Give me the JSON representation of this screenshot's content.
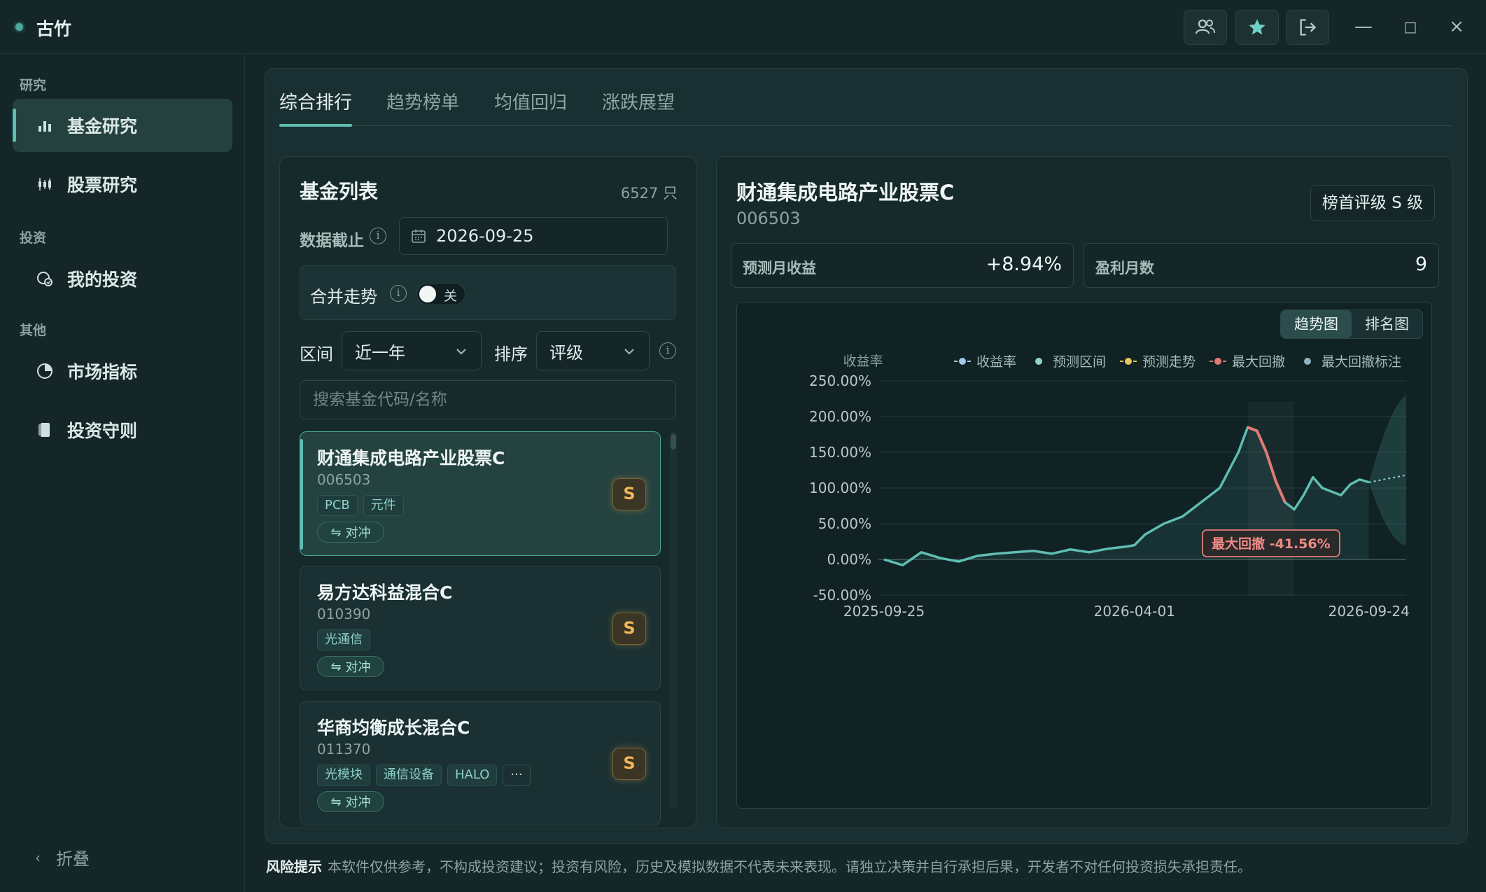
{
  "app": {
    "name": "古竹"
  },
  "window": {
    "minimize": "—",
    "maximize": "□",
    "close": "×"
  },
  "sidebar": {
    "sections": [
      {
        "label": "研究"
      },
      {
        "label": "投资"
      },
      {
        "label": "其他"
      }
    ],
    "items": [
      {
        "label": "基金研究",
        "icon": "bar-chart-icon"
      },
      {
        "label": "股票研究",
        "icon": "candlestick-icon"
      },
      {
        "label": "我的投资",
        "icon": "portfolio-icon"
      },
      {
        "label": "市场指标",
        "icon": "pie-chart-icon"
      },
      {
        "label": "投资守则",
        "icon": "book-icon"
      }
    ],
    "collapse_label": "折叠"
  },
  "tabs": [
    {
      "label": "综合排行",
      "active": true
    },
    {
      "label": "趋势榜单"
    },
    {
      "label": "均值回归"
    },
    {
      "label": "涨跌展望"
    }
  ],
  "fund_list": {
    "title": "基金列表",
    "count": "6527 只",
    "date_label": "数据截止",
    "date_value": "2026-09-25",
    "merge_label": "合并走势",
    "merge_toggle": "关",
    "range_label": "区间",
    "range_value": "近一年",
    "sort_label": "排序",
    "sort_value": "评级",
    "search_placeholder": "搜索基金代码/名称",
    "items": [
      {
        "name": "财通集成电路产业股票C",
        "code": "006503",
        "tags": [
          "PCB",
          "元件"
        ],
        "hedge": "对冲",
        "grade": "S"
      },
      {
        "name": "易方达科益混合C",
        "code": "010390",
        "tags": [
          "光通信"
        ],
        "hedge": "对冲",
        "grade": "S"
      },
      {
        "name": "华商均衡成长混合C",
        "code": "011370",
        "tags": [
          "光模块",
          "通信设备",
          "HALO",
          "···"
        ],
        "hedge": "对冲",
        "grade": "S"
      }
    ]
  },
  "detail": {
    "name": "财通集成电路产业股票C",
    "code": "006503",
    "rank_badge": "榜首评级 S 级",
    "metrics": [
      {
        "label": "预测月收益",
        "value": "+8.94%"
      },
      {
        "label": "盈利月数",
        "value": "9"
      }
    ],
    "views": [
      "趋势图",
      "排名图"
    ],
    "colors": {
      "accent": "#5fbdb2",
      "drawdown": "#e07a76",
      "forecast": "#e8c65a",
      "grade": "#f0b65a"
    }
  },
  "chart_data": {
    "type": "line",
    "title": "",
    "ylabel": "收益率",
    "ylim": [
      -50,
      250
    ],
    "yticks": [
      "250.00%",
      "200.00%",
      "150.00%",
      "100.00%",
      "50.00%",
      "0.00%",
      "-50.00%"
    ],
    "xticks": [
      "2025-09-25",
      "2026-04-01",
      "2026-09-24"
    ],
    "legend": [
      "收益率",
      "预测区间",
      "预测走势",
      "最大回撤",
      "最大回撤标注"
    ],
    "legend_position": "top",
    "annotation": "最大回撤 -41.56%",
    "series": [
      {
        "name": "收益率",
        "x": [
          "2025-09-25",
          "2025-10-09",
          "2025-10-23",
          "2025-11-06",
          "2025-11-20",
          "2025-12-04",
          "2025-12-18",
          "2026-01-01",
          "2026-01-15",
          "2026-01-29",
          "2026-02-12",
          "2026-02-26",
          "2026-03-12",
          "2026-03-26",
          "2026-04-01",
          "2026-04-09",
          "2026-04-23",
          "2026-05-07",
          "2026-05-21",
          "2026-06-04",
          "2026-06-18",
          "2026-06-25",
          "2026-07-02",
          "2026-07-09",
          "2026-07-16",
          "2026-07-23",
          "2026-07-30",
          "2026-08-06",
          "2026-08-13",
          "2026-08-20",
          "2026-08-27",
          "2026-09-03",
          "2026-09-10",
          "2026-09-17",
          "2026-09-24"
        ],
        "values": [
          0,
          -8,
          10,
          2,
          -3,
          5,
          8,
          10,
          12,
          8,
          14,
          10,
          15,
          18,
          20,
          35,
          50,
          60,
          80,
          100,
          150,
          185,
          180,
          150,
          110,
          80,
          70,
          90,
          115,
          100,
          95,
          90,
          105,
          112,
          108
        ]
      },
      {
        "name": "预测走势",
        "x": [
          "2026-09-24",
          "2026-10-08",
          "2026-10-22"
        ],
        "values": [
          108,
          113,
          118
        ]
      }
    ]
  },
  "footer": {
    "risk_title": "风险提示",
    "risk_text": "本软件仅供参考，不构成投资建议；投资有风险，历史及模拟数据不代表未来表现。请独立决策并自行承担后果，开发者不对任何投资损失承担责任。"
  }
}
